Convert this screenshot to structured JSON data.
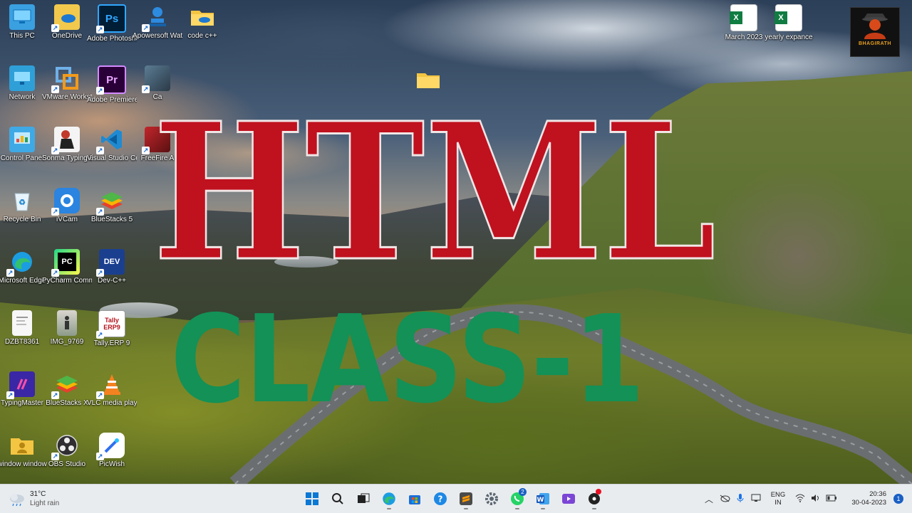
{
  "desktop": {
    "icons": [
      {
        "label": "This PC",
        "icon": "monitor-icon"
      },
      {
        "label": "OneDrive",
        "icon": "onedrive-folder-icon"
      },
      {
        "label": "Adobe Photosho...",
        "icon": "photoshop-icon"
      },
      {
        "label": "Apowersoft Watermar...",
        "icon": "apowersoft-stamp-icon"
      },
      {
        "label": "code c++",
        "icon": "folder-icon"
      },
      {
        "label": "Network",
        "icon": "network-icon"
      },
      {
        "label": "VMware Workstati...",
        "icon": "vmware-icon"
      },
      {
        "label": "Adobe Premiere Pr...",
        "icon": "premiere-icon"
      },
      {
        "label": "Ca",
        "icon": "game-icon"
      },
      {
        "label": "Control Panel",
        "icon": "control-panel-icon"
      },
      {
        "label": "Sonma Typing-Exp...",
        "icon": "typing-icon"
      },
      {
        "label": "Visual Studio Code",
        "icon": "vscode-icon"
      },
      {
        "label": "FreeFire A",
        "icon": "freefire-icon"
      },
      {
        "label": "Recycle Bin",
        "icon": "recycle-bin-icon"
      },
      {
        "label": "iVCam",
        "icon": "ivcam-icon"
      },
      {
        "label": "BlueStacks 5",
        "icon": "bluestacks-icon"
      },
      {
        "label": "Microsoft Edge",
        "icon": "edge-icon"
      },
      {
        "label": "PyCharm Communi...",
        "icon": "pycharm-icon"
      },
      {
        "label": "Dev-C++",
        "icon": "devcpp-icon"
      },
      {
        "label": "DZBT8361",
        "icon": "document-icon"
      },
      {
        "label": "IMG_9769",
        "icon": "image-icon"
      },
      {
        "label": "Tally.ERP 9",
        "icon": "tally-icon"
      },
      {
        "label": "TypingMaster",
        "icon": "typingmaster-icon"
      },
      {
        "label": "BlueStacks X",
        "icon": "bluestacks-x-icon"
      },
      {
        "label": "VLC media player",
        "icon": "vlc-icon"
      },
      {
        "label": "window window",
        "icon": "user-folder-icon"
      },
      {
        "label": "OBS Studio",
        "icon": "obs-icon"
      },
      {
        "label": "PicWish",
        "icon": "picwish-icon"
      },
      {
        "label": "March 2023",
        "icon": "excel-icon"
      },
      {
        "label": "yearly expance",
        "icon": "excel-icon"
      },
      {
        "label": "",
        "icon": "folder-icon"
      }
    ],
    "logo_text": "BHAGIRATH"
  },
  "overlay": {
    "title": "HTML",
    "subtitle": "CLASS-1",
    "title_color": "#c0111f",
    "subtitle_color": "#139157"
  },
  "taskbar": {
    "weather": {
      "temp": "31°C",
      "condition": "Light rain"
    },
    "apps": [
      {
        "icon": "windows-start-icon"
      },
      {
        "icon": "search-icon"
      },
      {
        "icon": "task-view-icon"
      },
      {
        "icon": "edge-icon"
      },
      {
        "icon": "store-icon"
      },
      {
        "icon": "help-icon"
      },
      {
        "icon": "sublime-icon"
      },
      {
        "icon": "settings-icon"
      },
      {
        "icon": "whatsapp-icon",
        "badge": "2"
      },
      {
        "icon": "word-icon"
      },
      {
        "icon": "clipchamp-icon"
      },
      {
        "icon": "media-icon"
      }
    ],
    "tray": {
      "lang_top": "ENG",
      "lang_bottom": "IN",
      "time": "20:36",
      "date": "30-04-2023",
      "notifications": "1"
    }
  },
  "colors": {
    "taskbar_bg": "#e9ecef",
    "title_red": "#c0111f",
    "subtitle_green": "#139157"
  }
}
